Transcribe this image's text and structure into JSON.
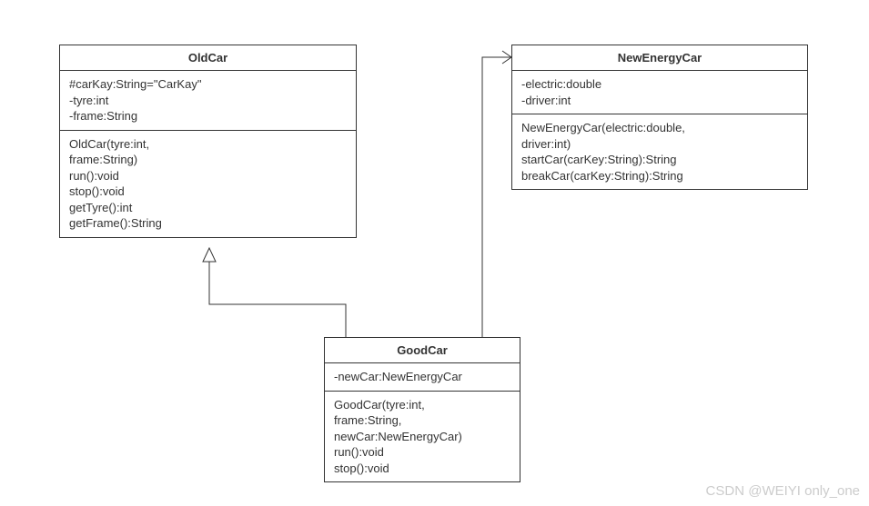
{
  "classes": {
    "oldcar": {
      "name": "OldCar",
      "attributes": "#carKay:String=\"CarKay\"\n-tyre:int\n-frame:String",
      "operations": "OldCar(tyre:int,\nframe:String)\nrun():void\nstop():void\ngetTyre():int\ngetFrame():String"
    },
    "newenergycar": {
      "name": "NewEnergyCar",
      "attributes": "-electric:double\n-driver:int",
      "operations": "NewEnergyCar(electric:double,\ndriver:int)\nstartCar(carKey:String):String\nbreakCar(carKey:String):String"
    },
    "goodcar": {
      "name": "GoodCar",
      "attributes": "-newCar:NewEnergyCar",
      "operations": "GoodCar(tyre:int,\nframe:String,\nnewCar:NewEnergyCar)\nrun():void\nstop():void"
    }
  },
  "watermark": "CSDN @WEIYI only_one"
}
